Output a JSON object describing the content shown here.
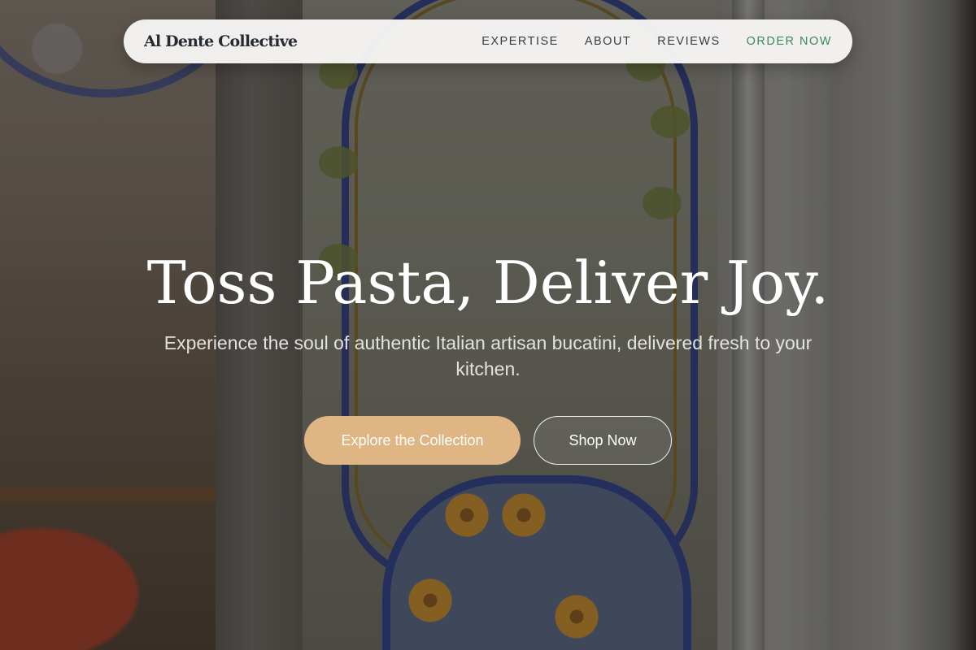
{
  "brand": {
    "name": "Al Dente Collective"
  },
  "nav": {
    "items": [
      {
        "label": "EXPERTISE"
      },
      {
        "label": "ABOUT"
      },
      {
        "label": "REVIEWS"
      },
      {
        "label": "ORDER NOW"
      }
    ]
  },
  "hero": {
    "title": "Toss Pasta, Deliver Joy.",
    "subtitle": "Experience the soul of authentic Italian artisan bucatini, delivered fresh to your kitchen.",
    "primary_button": "Explore the Collection",
    "secondary_button": "Shop Now"
  },
  "colors": {
    "accent": "#dfb583",
    "nav_cta": "#3a8a5a",
    "nav_bg": "#f6f5f3",
    "brand_text": "#262a33"
  },
  "background_image": "blurred-storefront-with-tiled-italian-shop-sign"
}
